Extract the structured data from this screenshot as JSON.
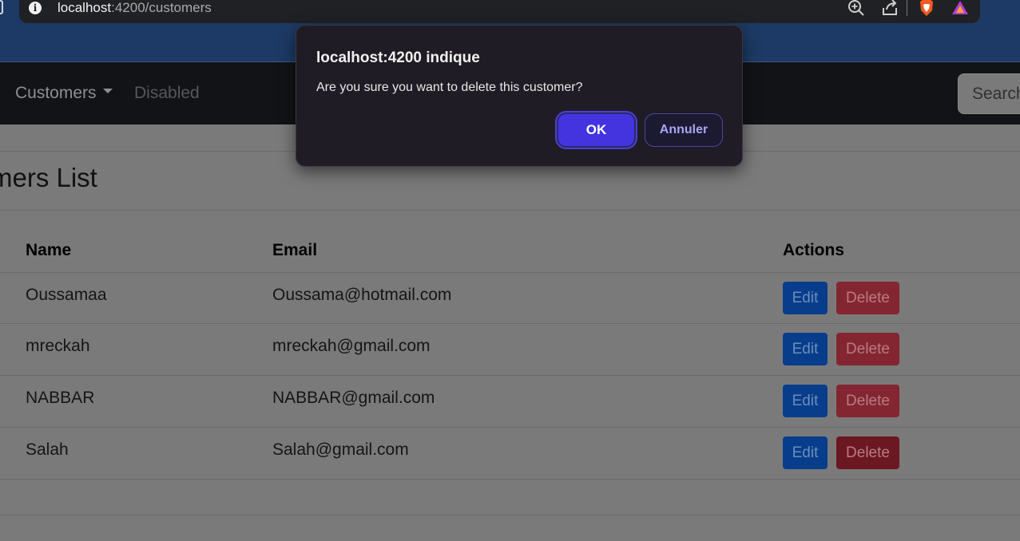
{
  "browser": {
    "url_host": "localhost",
    "url_path": ":4200/customers",
    "icons": [
      "info-icon",
      "zoom-icon",
      "share-icon",
      "brave-shield-icon",
      "brave-rewards-icon"
    ]
  },
  "navbar": {
    "items": [
      {
        "label": "Customers",
        "dropdown": true
      },
      {
        "label": "Disabled",
        "disabled": true
      }
    ],
    "search_placeholder": "Search"
  },
  "page": {
    "title": "mers List",
    "table": {
      "headers": [
        "Name",
        "Email",
        "Actions"
      ],
      "rows": [
        {
          "name": "Oussamaa",
          "email": "Oussama@hotmail.com"
        },
        {
          "name": "mreckah",
          "email": "mreckah@gmail.com"
        },
        {
          "name": "NABBAR",
          "email": "NABBAR@gmail.com"
        },
        {
          "name": "Salah",
          "email": "Salah@gmail.com"
        }
      ],
      "edit_label": "Edit",
      "delete_label": "Delete"
    }
  },
  "dialog": {
    "title": "localhost:4200 indique",
    "message": "Are you sure you want to delete this customer?",
    "ok_label": "OK",
    "cancel_label": "Annuler"
  },
  "colors": {
    "ok_button": "#4434e0",
    "edit_button": "#083d8c",
    "delete_button": "#842631",
    "navbar": "#121316"
  }
}
